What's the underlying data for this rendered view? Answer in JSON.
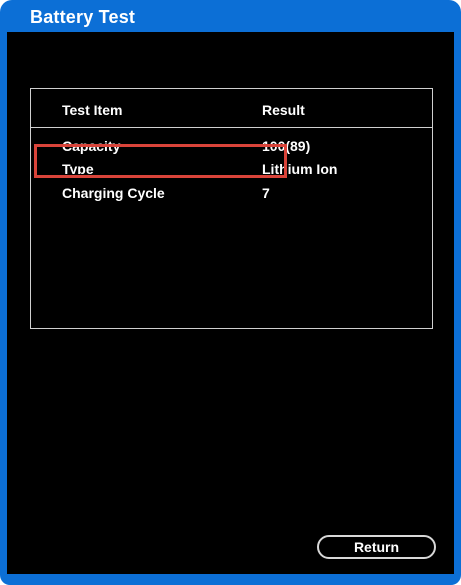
{
  "window": {
    "title": "Battery Test"
  },
  "table": {
    "headers": {
      "item": "Test Item",
      "result": "Result"
    },
    "rows": [
      {
        "item": "Capacity",
        "result": "100(89)"
      },
      {
        "item": "Type",
        "result": "Lithium Ion"
      },
      {
        "item": "Charging Cycle",
        "result": "7"
      }
    ]
  },
  "buttons": {
    "return_label": "Return"
  },
  "colors": {
    "frame": "#0c6fd6",
    "screen": "#000000",
    "highlight": "#d9443a"
  }
}
